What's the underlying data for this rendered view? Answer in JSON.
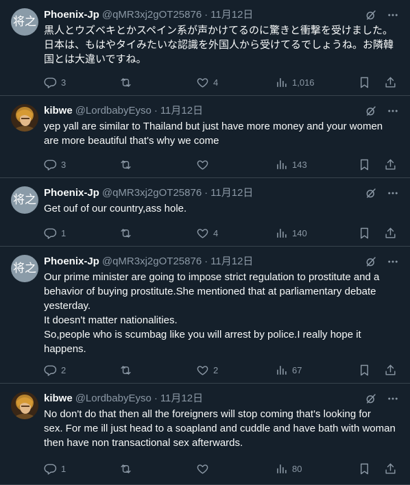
{
  "tweets": [
    {
      "avatar_text": "将之",
      "avatar_type": "text",
      "name": "Phoenix-Jp",
      "handle": "@qMR3xj2gOT25876",
      "dot": "·",
      "date": "11月12日",
      "text": "黒人とウズベキとかスペイン系が声かけてるのに驚きと衝撃を受けました。\n日本は、もはやタイみたいな認識を外国人から受けてるでしょうね。お隣韓\n国とは大違いですね。",
      "replies": "3",
      "retweets": "",
      "likes": "4",
      "views": "1,016"
    },
    {
      "avatar_text": "",
      "avatar_type": "image",
      "name": "kibwe",
      "handle": "@LordbabyEyso",
      "dot": "·",
      "date": "11月12日",
      "text": "yep yall are similar to Thailand but just have more money and your women\nare more beautiful that's why we come",
      "replies": "3",
      "retweets": "",
      "likes": "",
      "views": "143"
    },
    {
      "avatar_text": "将之",
      "avatar_type": "text",
      "name": "Phoenix-Jp",
      "handle": "@qMR3xj2gOT25876",
      "dot": "·",
      "date": "11月12日",
      "text": "Get ouf of our country,ass hole.",
      "replies": "1",
      "retweets": "",
      "likes": "4",
      "views": "140"
    },
    {
      "avatar_text": "将之",
      "avatar_type": "text",
      "name": "Phoenix-Jp",
      "handle": "@qMR3xj2gOT25876",
      "dot": "·",
      "date": "11月12日",
      "text": "Our prime minister are going to impose strict regulation to prostitute and a\nbehavior of buying prostitute.She mentioned that at parliamentary debate\nyesterday.\nIt doesn't matter nationalities.\nSo,people who is scumbag like you will arrest by police.I really hope it\nhappens.",
      "replies": "2",
      "retweets": "",
      "likes": "2",
      "views": "67"
    },
    {
      "avatar_text": "",
      "avatar_type": "image",
      "name": "kibwe",
      "handle": "@LordbabyEyso",
      "dot": "·",
      "date": "11月12日",
      "text": "No don't do that then all the foreigners will stop coming that's looking for\nsex. For me ill just head to a soapland and cuddle and have bath with woman\nthen have non transactional sex afterwards.",
      "replies": "1",
      "retweets": "",
      "likes": "",
      "views": "80"
    }
  ],
  "colors": {
    "background": "#15202b",
    "text": "#f7f9f9",
    "secondary": "#8b98a5",
    "divider": "#38444d"
  },
  "icons": [
    "grok-icon",
    "more-icon",
    "reply-icon",
    "retweet-icon",
    "like-icon",
    "views-icon",
    "bookmark-icon",
    "share-icon"
  ]
}
